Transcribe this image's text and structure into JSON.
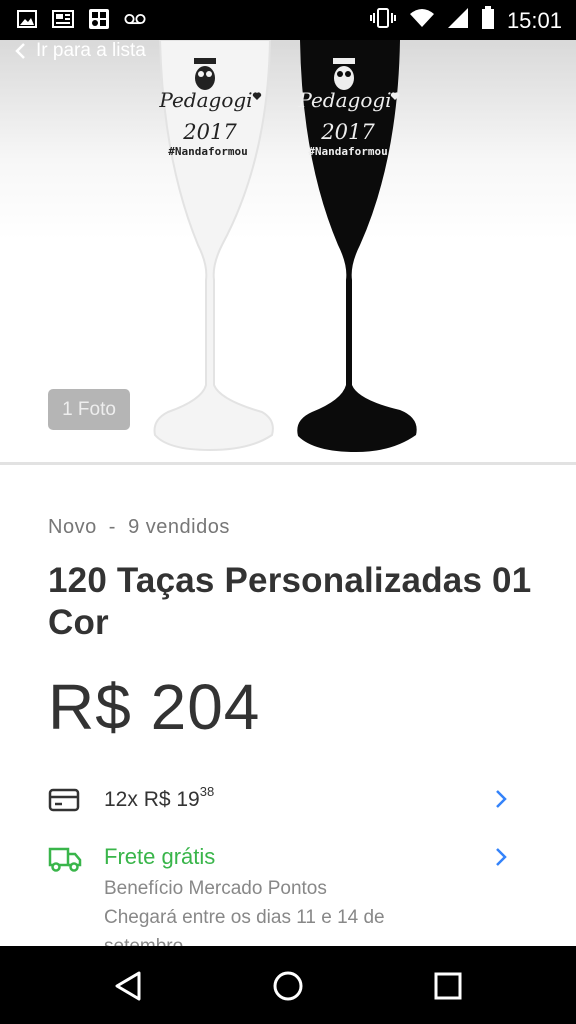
{
  "status_bar": {
    "time": "15:01",
    "left_icons": [
      "image-icon",
      "news-icon",
      "app-icon",
      "voicemail-icon"
    ],
    "right_icons": [
      "vibrate-icon",
      "wifi-icon",
      "signal-icon",
      "battery-icon"
    ]
  },
  "header": {
    "back_label": "Ir para a lista"
  },
  "gallery": {
    "photo_count": "1 Foto",
    "glass_text": {
      "brand": "Pedagogi",
      "year": "2017",
      "hashtag": "#Nandaformou"
    }
  },
  "product": {
    "condition": "Novo  -  9 vendidos",
    "title": "120 Taças Personalizadas 01 Cor",
    "price": "R$ 204"
  },
  "installments": {
    "text": "12x R$ 19",
    "cents": "38"
  },
  "shipping": {
    "title": "Frete grátis",
    "line1": "Benefício Mercado Pontos",
    "line2": "Chegará entre os dias 11 e 14 de",
    "line3": "setembro"
  },
  "colors": {
    "green": "#39b54a",
    "blue_chevron": "#3483fa",
    "text_dark": "#333333"
  }
}
